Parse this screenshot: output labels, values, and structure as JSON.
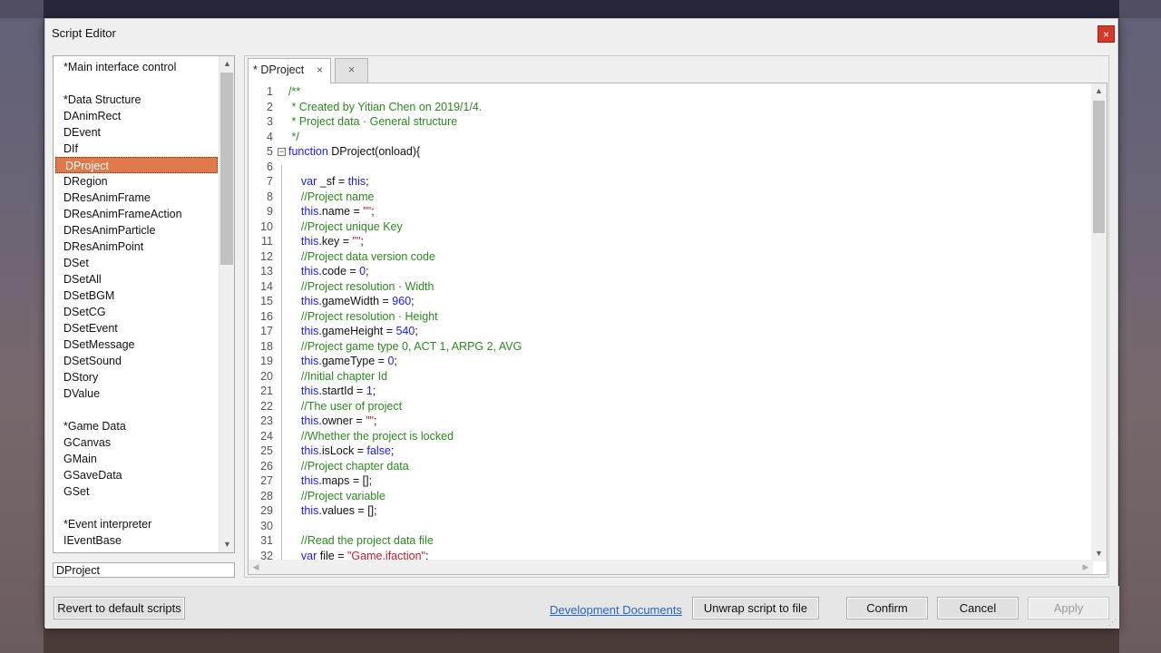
{
  "window": {
    "title": "Script Editor",
    "close_symbol": "×"
  },
  "script_list": {
    "items": [
      {
        "label": "*Main interface control"
      },
      {
        "label": ""
      },
      {
        "label": "*Data Structure"
      },
      {
        "label": "DAnimRect"
      },
      {
        "label": "DEvent"
      },
      {
        "label": "DIf"
      },
      {
        "label": "DProject",
        "selected": true
      },
      {
        "label": "DRegion"
      },
      {
        "label": "DResAnimFrame"
      },
      {
        "label": "DResAnimFrameAction"
      },
      {
        "label": "DResAnimParticle"
      },
      {
        "label": "DResAnimPoint"
      },
      {
        "label": "DSet"
      },
      {
        "label": "DSetAll"
      },
      {
        "label": "DSetBGM"
      },
      {
        "label": "DSetCG"
      },
      {
        "label": "DSetEvent"
      },
      {
        "label": "DSetMessage"
      },
      {
        "label": "DSetSound"
      },
      {
        "label": "DStory"
      },
      {
        "label": "DValue"
      },
      {
        "label": ""
      },
      {
        "label": "*Game Data"
      },
      {
        "label": "GCanvas"
      },
      {
        "label": "GMain"
      },
      {
        "label": "GSaveData"
      },
      {
        "label": "GSet"
      },
      {
        "label": ""
      },
      {
        "label": "*Event interpreter"
      },
      {
        "label": "IEventBase"
      }
    ],
    "filter_value": "DProject"
  },
  "tabs": [
    {
      "label": "* DProject",
      "close_symbol": "×",
      "active": true
    },
    {
      "label": "",
      "close_symbol": "×",
      "active": false
    }
  ],
  "code_lines": [
    {
      "n": "1",
      "tokens": [
        {
          "t": "/**",
          "c": "c"
        }
      ]
    },
    {
      "n": "2",
      "tokens": [
        {
          "t": " * Created by Yitian Chen on 2019/1/4.",
          "c": "c"
        }
      ]
    },
    {
      "n": "3",
      "tokens": [
        {
          "t": " * Project data · General structure",
          "c": "c"
        }
      ]
    },
    {
      "n": "4",
      "tokens": [
        {
          "t": " */",
          "c": "c"
        }
      ]
    },
    {
      "n": "5",
      "fold": true,
      "tokens": [
        {
          "t": "function",
          "c": "k"
        },
        {
          "t": " DProject(onload){",
          "c": "p"
        }
      ]
    },
    {
      "n": "6",
      "tokens": []
    },
    {
      "n": "7",
      "tokens": [
        {
          "t": "    var",
          "c": "k"
        },
        {
          "t": " _sf = ",
          "c": "p"
        },
        {
          "t": "this",
          "c": "k"
        },
        {
          "t": ";",
          "c": "p"
        }
      ]
    },
    {
      "n": "8",
      "tokens": [
        {
          "t": "    //Project name",
          "c": "c"
        }
      ]
    },
    {
      "n": "9",
      "tokens": [
        {
          "t": "    this",
          "c": "k"
        },
        {
          "t": ".name = ",
          "c": "p"
        },
        {
          "t": "\"\"",
          "c": "s"
        },
        {
          "t": ";",
          "c": "p"
        }
      ]
    },
    {
      "n": "10",
      "tokens": [
        {
          "t": "    //Project unique Key",
          "c": "c"
        }
      ]
    },
    {
      "n": "11",
      "tokens": [
        {
          "t": "    this",
          "c": "k"
        },
        {
          "t": ".key = ",
          "c": "p"
        },
        {
          "t": "\"\"",
          "c": "s"
        },
        {
          "t": ";",
          "c": "p"
        }
      ]
    },
    {
      "n": "12",
      "tokens": [
        {
          "t": "    //Project data version code",
          "c": "c"
        }
      ]
    },
    {
      "n": "13",
      "tokens": [
        {
          "t": "    this",
          "c": "k"
        },
        {
          "t": ".code = ",
          "c": "p"
        },
        {
          "t": "0",
          "c": "n"
        },
        {
          "t": ";",
          "c": "p"
        }
      ]
    },
    {
      "n": "14",
      "tokens": [
        {
          "t": "    //Project resolution · Width",
          "c": "c"
        }
      ]
    },
    {
      "n": "15",
      "tokens": [
        {
          "t": "    this",
          "c": "k"
        },
        {
          "t": ".gameWidth = ",
          "c": "p"
        },
        {
          "t": "960",
          "c": "n"
        },
        {
          "t": ";",
          "c": "p"
        }
      ]
    },
    {
      "n": "16",
      "tokens": [
        {
          "t": "    //Project resolution · Height",
          "c": "c"
        }
      ]
    },
    {
      "n": "17",
      "tokens": [
        {
          "t": "    this",
          "c": "k"
        },
        {
          "t": ".gameHeight = ",
          "c": "p"
        },
        {
          "t": "540",
          "c": "n"
        },
        {
          "t": ";",
          "c": "p"
        }
      ]
    },
    {
      "n": "18",
      "tokens": [
        {
          "t": "    //Project game type 0, ACT 1, ARPG 2, AVG",
          "c": "c"
        }
      ]
    },
    {
      "n": "19",
      "tokens": [
        {
          "t": "    this",
          "c": "k"
        },
        {
          "t": ".gameType = ",
          "c": "p"
        },
        {
          "t": "0",
          "c": "n"
        },
        {
          "t": ";",
          "c": "p"
        }
      ]
    },
    {
      "n": "20",
      "tokens": [
        {
          "t": "    //Initial chapter Id",
          "c": "c"
        }
      ]
    },
    {
      "n": "21",
      "tokens": [
        {
          "t": "    this",
          "c": "k"
        },
        {
          "t": ".startId = ",
          "c": "p"
        },
        {
          "t": "1",
          "c": "n"
        },
        {
          "t": ";",
          "c": "p"
        }
      ]
    },
    {
      "n": "22",
      "tokens": [
        {
          "t": "    //The user of project",
          "c": "c"
        }
      ]
    },
    {
      "n": "23",
      "tokens": [
        {
          "t": "    this",
          "c": "k"
        },
        {
          "t": ".owner = ",
          "c": "p"
        },
        {
          "t": "\"\"",
          "c": "s"
        },
        {
          "t": ";",
          "c": "p"
        }
      ]
    },
    {
      "n": "24",
      "tokens": [
        {
          "t": "    //Whether the project is locked",
          "c": "c"
        }
      ]
    },
    {
      "n": "25",
      "tokens": [
        {
          "t": "    this",
          "c": "k"
        },
        {
          "t": ".isLock = ",
          "c": "p"
        },
        {
          "t": "false",
          "c": "k"
        },
        {
          "t": ";",
          "c": "p"
        }
      ]
    },
    {
      "n": "26",
      "tokens": [
        {
          "t": "    //Project chapter data",
          "c": "c"
        }
      ]
    },
    {
      "n": "27",
      "tokens": [
        {
          "t": "    this",
          "c": "k"
        },
        {
          "t": ".maps = [];",
          "c": "p"
        }
      ]
    },
    {
      "n": "28",
      "tokens": [
        {
          "t": "    //Project variable",
          "c": "c"
        }
      ]
    },
    {
      "n": "29",
      "tokens": [
        {
          "t": "    this",
          "c": "k"
        },
        {
          "t": ".values = [];",
          "c": "p"
        }
      ]
    },
    {
      "n": "30",
      "tokens": []
    },
    {
      "n": "31",
      "tokens": [
        {
          "t": "    //Read the project data file",
          "c": "c"
        }
      ]
    },
    {
      "n": "32",
      "tokens": [
        {
          "t": "    var",
          "c": "k"
        },
        {
          "t": " file = ",
          "c": "p"
        },
        {
          "t": "\"Game.ifaction\"",
          "c": "s"
        },
        {
          "t": ";",
          "c": "p"
        }
      ]
    }
  ],
  "buttons": {
    "revert": "Revert to default scripts",
    "docs_link": "Development Documents",
    "unwrap": "Unwrap script to file",
    "confirm": "Confirm",
    "cancel": "Cancel",
    "apply": "Apply"
  },
  "icons": {
    "scroll_up": "▲",
    "scroll_down": "▼",
    "scroll_left": "◀",
    "scroll_right": "▶",
    "fold_symbol": "−",
    "grip": "⋰"
  },
  "colors": {
    "selection": "#e07a4a",
    "comment": "#2b8a1e",
    "keyword": "#1a1aff",
    "string": "#c02030",
    "close_button": "#d23a2a",
    "link": "#2466c8"
  }
}
